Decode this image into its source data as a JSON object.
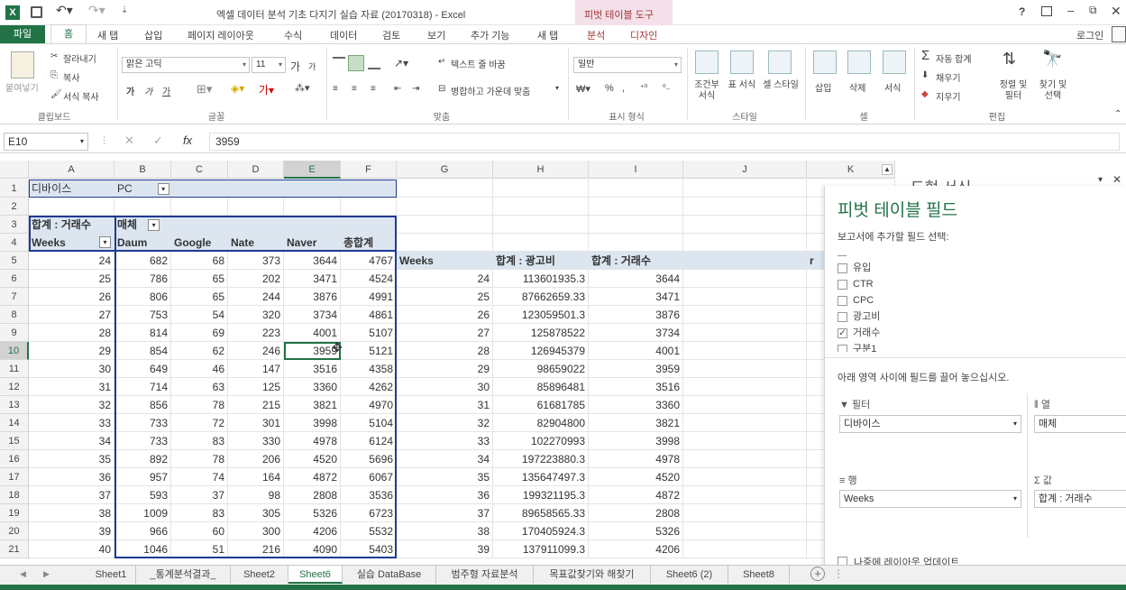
{
  "app": {
    "title": "엑셀 데이터 분석 기초 다지기 실습 자료 (20170318) - Excel",
    "context_tab": "피벗 테이블 도구",
    "help": "?",
    "signin": "로그인"
  },
  "tabs": [
    "파일",
    "홈",
    "새 탭",
    "삽입",
    "페이지 레이아웃",
    "수식",
    "데이터",
    "검토",
    "보기",
    "추가 기능",
    "새 탭",
    "분석",
    "디자인"
  ],
  "ribbon": {
    "clipboard": {
      "paste": "붙여넣기",
      "cut": "잘라내기",
      "copy": "복사",
      "format_painter": "서식 복사",
      "label": "클립보드"
    },
    "font": {
      "name": "맑은 고딕",
      "size": "11",
      "grow": "가",
      "shrink": "가",
      "bold": "가",
      "italic": "가",
      "underline": "가",
      "label": "글꼴"
    },
    "align": {
      "wrap": "텍스트 줄 바꿈",
      "merge": "병합하고 가운데 맞춤",
      "label": "맞춤"
    },
    "number": {
      "format": "일반",
      "label": "표시 형식"
    },
    "styles": {
      "cond": "조건부 서식",
      "table": "표 서식",
      "cell": "셀 스타일",
      "label": "스타일"
    },
    "cells": {
      "insert": "삽입",
      "delete": "삭제",
      "format": "서식",
      "label": "셀"
    },
    "edit": {
      "autosum": "자동 합계",
      "fill": "채우기",
      "clear": "지우기",
      "sort": "정렬 및 필터",
      "find": "찾기 및 선택",
      "label": "편집"
    }
  },
  "formula": {
    "namebox": "E10",
    "value": "3959"
  },
  "columns": [
    "A",
    "B",
    "C",
    "D",
    "E",
    "F",
    "G",
    "H",
    "I",
    "J",
    "K"
  ],
  "rows": [
    "1",
    "2",
    "3",
    "4",
    "5",
    "6",
    "7",
    "8",
    "9",
    "10",
    "11",
    "12",
    "13",
    "14",
    "15",
    "16",
    "17",
    "18",
    "19",
    "20",
    "21"
  ],
  "pivot1": {
    "filter_label": "디바이스",
    "filter_value": "PC",
    "sum_label": "합계 : 거래수",
    "col_label": "매체",
    "row_label": "Weeks",
    "headers": [
      "Daum",
      "Google",
      "Nate",
      "Naver",
      "총합계"
    ],
    "rows": [
      [
        "24",
        "682",
        "68",
        "373",
        "3644",
        "4767"
      ],
      [
        "25",
        "786",
        "65",
        "202",
        "3471",
        "4524"
      ],
      [
        "26",
        "806",
        "65",
        "244",
        "3876",
        "4991"
      ],
      [
        "27",
        "753",
        "54",
        "320",
        "3734",
        "4861"
      ],
      [
        "28",
        "814",
        "69",
        "223",
        "4001",
        "5107"
      ],
      [
        "29",
        "854",
        "62",
        "246",
        "3959",
        "5121"
      ],
      [
        "30",
        "649",
        "46",
        "147",
        "3516",
        "4358"
      ],
      [
        "31",
        "714",
        "63",
        "125",
        "3360",
        "4262"
      ],
      [
        "32",
        "856",
        "78",
        "215",
        "3821",
        "4970"
      ],
      [
        "33",
        "733",
        "72",
        "301",
        "3998",
        "5104"
      ],
      [
        "34",
        "733",
        "83",
        "330",
        "4978",
        "6124"
      ],
      [
        "35",
        "892",
        "78",
        "206",
        "4520",
        "5696"
      ],
      [
        "36",
        "957",
        "74",
        "164",
        "4872",
        "6067"
      ],
      [
        "37",
        "593",
        "37",
        "98",
        "2808",
        "3536"
      ],
      [
        "38",
        "1009",
        "83",
        "305",
        "5326",
        "6723"
      ],
      [
        "39",
        "966",
        "60",
        "300",
        "4206",
        "5532"
      ],
      [
        "40",
        "1046",
        "51",
        "216",
        "4090",
        "5403"
      ]
    ]
  },
  "pivot2": {
    "headers": [
      "Weeks",
      "합계 : 광고비",
      "합계 : 거래수"
    ],
    "rows": [
      [
        "24",
        "113601935.3",
        "3644"
      ],
      [
        "25",
        "87662659.33",
        "3471"
      ],
      [
        "26",
        "123059501.3",
        "3876"
      ],
      [
        "27",
        "125878522",
        "3734"
      ],
      [
        "28",
        "126945379",
        "4001"
      ],
      [
        "29",
        "98659022",
        "3959"
      ],
      [
        "30",
        "85896481",
        "3516"
      ],
      [
        "31",
        "61681785",
        "3360"
      ],
      [
        "32",
        "82904800",
        "3821"
      ],
      [
        "33",
        "102270993",
        "3998"
      ],
      [
        "34",
        "197223880.3",
        "4978"
      ],
      [
        "35",
        "135647497.3",
        "4520"
      ],
      [
        "36",
        "199321195.3",
        "4872"
      ],
      [
        "37",
        "89658565.33",
        "2808"
      ],
      [
        "38",
        "170405924.3",
        "5326"
      ],
      [
        "39",
        "137911099.3",
        "4206"
      ]
    ]
  },
  "k5": "r",
  "shape_pane_title": "도형 서식",
  "pane": {
    "title": "피벗 테이블 필드",
    "subtitle": "보고서에 추가할 필드 선택:",
    "fields": [
      {
        "label": "유입",
        "checked": false
      },
      {
        "label": "CTR",
        "checked": false
      },
      {
        "label": "CPC",
        "checked": false
      },
      {
        "label": "광고비",
        "checked": false
      },
      {
        "label": "거래수",
        "checked": true
      },
      {
        "label": "구분1",
        "checked": false
      }
    ],
    "drag_hint": "아래 영역 사이에 필드를 끌어 놓으십시오.",
    "filter_label": "필터",
    "filter_value": "디바이스",
    "col_label": "열",
    "col_value": "매체",
    "row_label": "행",
    "row_value": "Weeks",
    "val_label": "값",
    "val_value": "합계 : 거래수",
    "defer": "나중에 레이아웃 업데이트"
  },
  "sheets": [
    "Sheet1",
    "_통계분석결과_",
    "Sheet2",
    "Sheet6",
    "실습 DataBase",
    "범주형 자료분석",
    "목표값찾기와 해찾기",
    "Sheet6 (2)",
    "Sheet8"
  ],
  "active_sheet": "Sheet6",
  "colors": {
    "excel_green": "#217346",
    "pivot_header": "#dce6f1",
    "context": "#f3e0e8",
    "pivot_border": "#1f3a93"
  }
}
